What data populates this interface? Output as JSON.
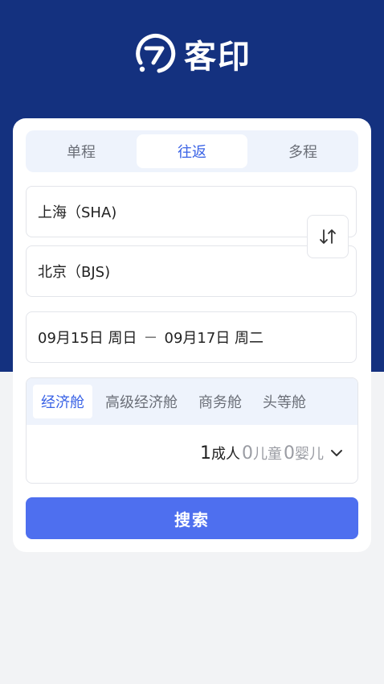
{
  "brand": {
    "name": "客印",
    "icon": "brand-logo-icon"
  },
  "trip_tabs": [
    {
      "label": "单程",
      "active": false
    },
    {
      "label": "往返",
      "active": true
    },
    {
      "label": "多程",
      "active": false
    }
  ],
  "from": {
    "value": "上海（SHA)"
  },
  "to": {
    "value": "北京（BJS)"
  },
  "swap": {
    "icon": "swap-icon"
  },
  "dates": {
    "depart": "09月15日 周日",
    "separator": "－",
    "return": "09月17日 周二"
  },
  "cabin_tabs": [
    {
      "label": "经济舱",
      "active": true
    },
    {
      "label": "高级经济舱",
      "active": false
    },
    {
      "label": "商务舱",
      "active": false
    },
    {
      "label": "头等舱",
      "active": false
    }
  ],
  "passengers": {
    "adult_count": "1",
    "adult_label": "成人",
    "child_count": "0",
    "child_label": "儿童",
    "infant_count": "0",
    "infant_label": "婴儿"
  },
  "search": {
    "label": "搜索"
  },
  "colors": {
    "header": "#14317f",
    "accent": "#3a63e6",
    "button": "#4e6fef"
  }
}
